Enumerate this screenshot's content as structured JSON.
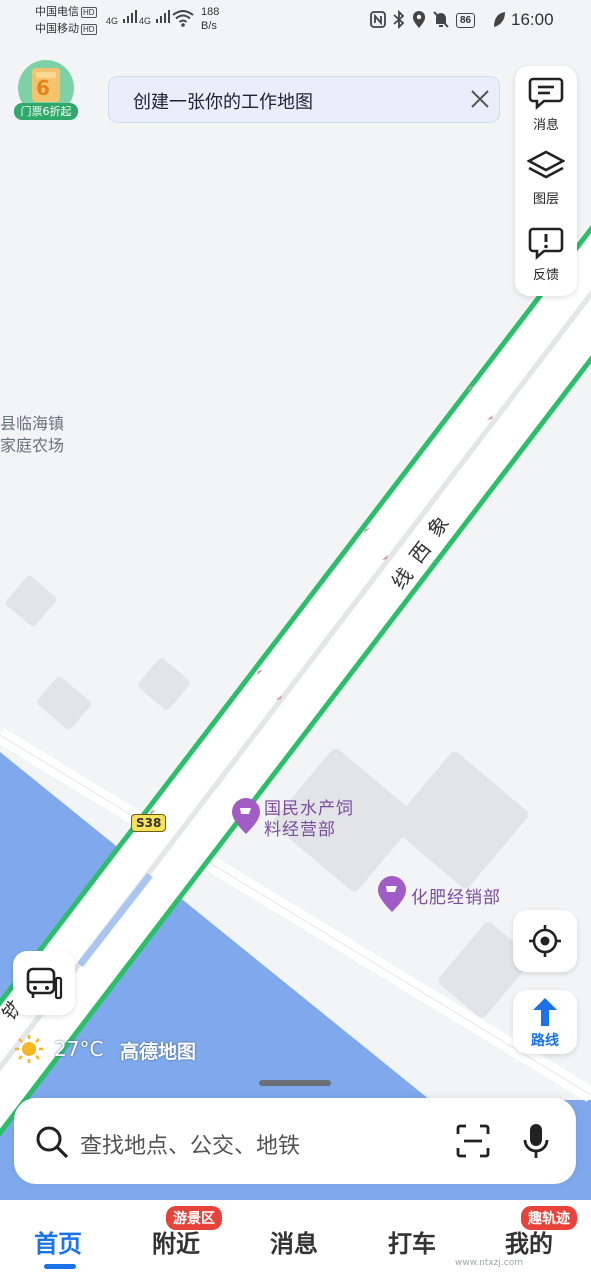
{
  "status_bar": {
    "carrier1": "中国电信",
    "carrier2": "中国移动",
    "hd": "HD",
    "net1": "4G",
    "net2": "4G",
    "speed_value": "188",
    "speed_unit": "B/s",
    "battery": "86",
    "time": "16:00"
  },
  "promo": {
    "badge_number": "6",
    "label": "门票6折起"
  },
  "banner": {
    "text": "创建一张你的工作地图"
  },
  "side_controls": {
    "messages": "消息",
    "layers": "图层",
    "feedback": "反馈"
  },
  "map": {
    "road_name": "象西线",
    "road_chars": [
      "象",
      "西",
      "线"
    ],
    "highway_shield": "S38",
    "area_label_line1": "县临海镇",
    "area_label_line2": "家庭农场",
    "poi1_line1": "国民水产饲",
    "poi1_line2": "料经营部",
    "poi2": "化肥经销部",
    "bottom_road_fragment": "铁"
  },
  "weather": {
    "temperature": "27°C",
    "brand": "高德地图"
  },
  "route_button": {
    "label": "路线"
  },
  "search": {
    "placeholder": "查找地点、公交、地铁"
  },
  "tabs": [
    {
      "label": "首页",
      "active": true
    },
    {
      "label": "附近",
      "badge": "游景区"
    },
    {
      "label": "消息"
    },
    {
      "label": "打车"
    },
    {
      "label": "我的",
      "badge": "趣轨迹"
    }
  ],
  "watermark": {
    "text": "www.ntxzj.com"
  },
  "colors": {
    "accent": "#1a73e8",
    "road_edge": "#2bbf6a",
    "water": "#7fa9ec",
    "poi": "#a25cc6",
    "badge": "#e8433b"
  }
}
